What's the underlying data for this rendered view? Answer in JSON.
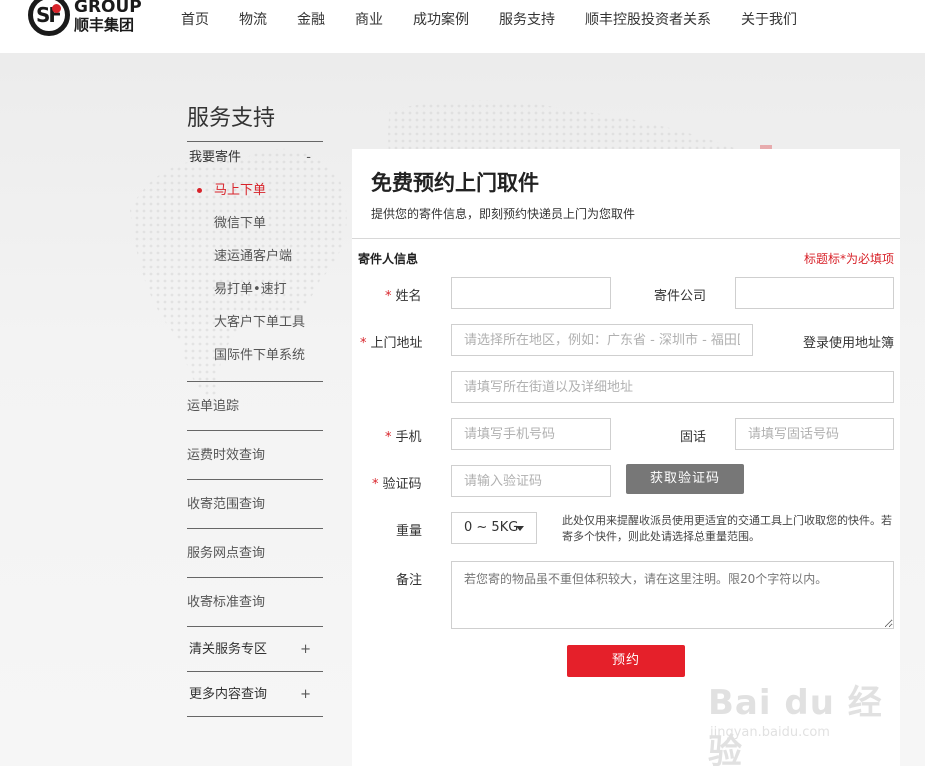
{
  "header": {
    "logo_group": "GROUP",
    "logo_name": "顺丰集团",
    "logo_mark": "SF",
    "nav": [
      "首页",
      "物流",
      "金融",
      "商业",
      "成功案例",
      "服务支持",
      "顺丰控股投资者关系",
      "关于我们"
    ]
  },
  "sidebar": {
    "title": "服务支持",
    "group1": {
      "label": "我要寄件",
      "toggle": "-"
    },
    "sub_items": [
      "马上下单",
      "微信下单",
      "速运通客户端",
      "易打单•速打",
      "大客户下单工具",
      "国际件下单系统"
    ],
    "links": [
      "运单追踪",
      "运费时效查询",
      "收寄范围查询",
      "服务网点查询",
      "收寄标准查询"
    ],
    "plus_groups": [
      {
        "label": "清关服务专区",
        "toggle": "+"
      },
      {
        "label": "更多内容查询",
        "toggle": "+"
      }
    ]
  },
  "form": {
    "title": "免费预约上门取件",
    "subtitle": "提供您的寄件信息，即刻预约快递员上门为您取件",
    "section_title": "寄件人信息",
    "required_note": "标题标*为必填项",
    "star": "*",
    "name_label": "姓名",
    "company_label": "寄件公司",
    "address_label": "上门地址",
    "address_region_placeholder": "请选择所在地区，例如：广东省 - 深圳市 - 福田区",
    "address_book_link": "登录使用地址簿",
    "address_detail_placeholder": "请填写所在街道以及详细地址",
    "mobile_label": "手机",
    "mobile_placeholder": "请填写手机号码",
    "phone_label": "固话",
    "phone_placeholder": "请填写固话号码",
    "code_label": "验证码",
    "code_placeholder": "请输入验证码",
    "get_code_button": "获取验证码",
    "weight_label": "重量",
    "weight_value": "0 ~ 5KG",
    "weight_note": "此处仅用来提醒收派员使用更适宜的交通工具上门收取您的快件。若寄多个快件，则此处请选择总重量范围。",
    "remark_label": "备注",
    "remark_placeholder": "若您寄的物品虽不重但体积较大，请在这里注明。限20个字符以内。",
    "submit_button": "预约"
  },
  "watermark": {
    "main": "Bai du 经验",
    "sub": "jingyan.baidu.com"
  },
  "colors": {
    "accent": "#d8232a",
    "button_red": "#e5202a",
    "button_gray": "#777777",
    "band_bg": "#efefef"
  }
}
